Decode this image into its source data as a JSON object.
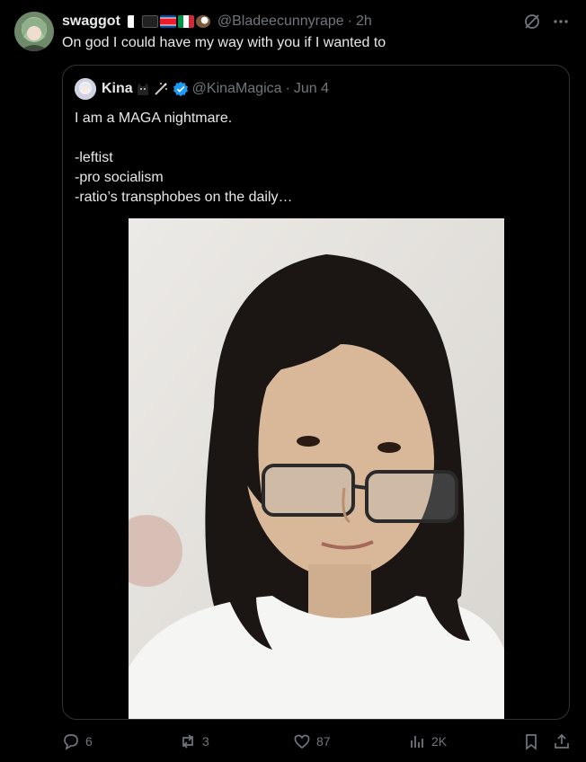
{
  "post": {
    "author_name": "swaggot",
    "author_handle": "@Bladeecunnyrape",
    "time": "2h",
    "dot": "·",
    "text": "On god I could have my way with you if I wanted to",
    "icons": [
      "grok-icon",
      "more-icon"
    ],
    "badge_icons": [
      "trans-flag-icon",
      "black-flag-icon",
      "north-korea-flag-icon",
      "italy-flag-icon",
      "eagle-icon"
    ]
  },
  "quote": {
    "author_name": "Kina",
    "emoji_icons": [
      "black-cat-icon",
      "magic-wand-icon"
    ],
    "verified_color": "#1d9bf0",
    "author_handle": "@KinaMagica",
    "dot": "·",
    "time": "Jun 4",
    "lines": [
      "I am a MAGA nightmare.",
      "",
      "-leftist",
      "-pro socialism",
      "-ratio’s transphobes on the daily…"
    ]
  },
  "actions": {
    "replies": "6",
    "reposts": "3",
    "likes": "87",
    "views": "2K"
  },
  "colors": {
    "background": "#000000",
    "text": "#e7e9ea",
    "muted": "#71767b",
    "border": "#2f3336",
    "accent": "#1d9bf0"
  }
}
